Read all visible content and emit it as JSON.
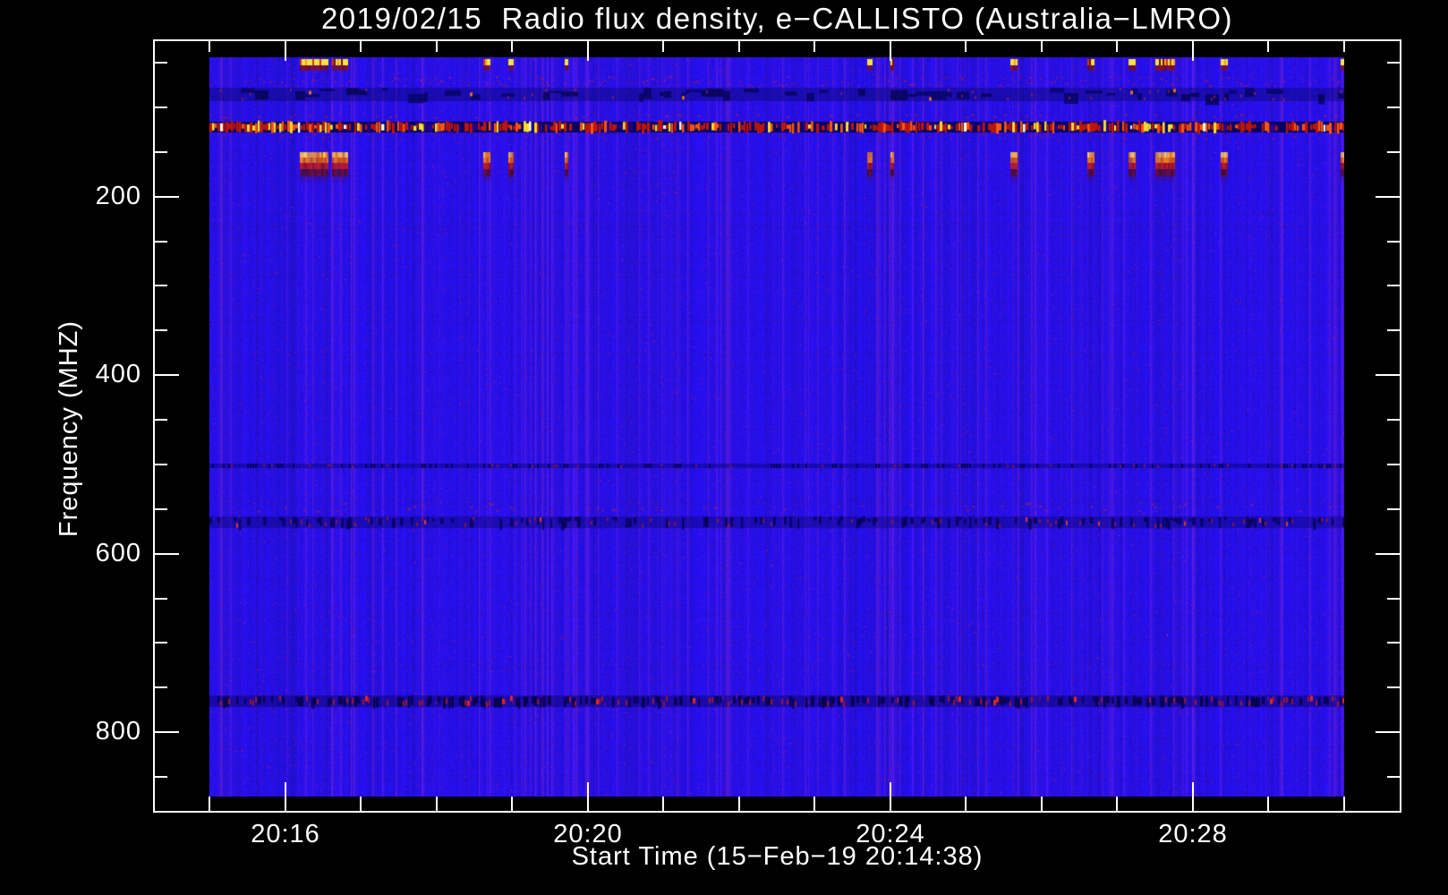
{
  "chart_data": {
    "type": "heatmap",
    "variant": "radio-spectrogram",
    "title": "2019/02/15  Radio flux density, e−CALLISTO (Australia−LMRO)",
    "xlabel": "Start Time (15−Feb−19 20:14:38)",
    "ylabel": "Frequency (MHZ)",
    "x_start_time": "20:15:00",
    "x_range_seconds": [
      0,
      900
    ],
    "x_minor_step_minutes": 1,
    "x_major_ticks": [
      {
        "t_min": 1,
        "label": "20:16"
      },
      {
        "t_min": 5,
        "label": "20:20"
      },
      {
        "t_min": 9,
        "label": "20:24"
      },
      {
        "t_min": 13,
        "label": "20:28"
      }
    ],
    "y_range_mhz": [
      44,
      872
    ],
    "y_minor_step_mhz": 50,
    "y_major_ticks": [
      {
        "f": 200,
        "label": "200"
      },
      {
        "f": 400,
        "label": "400"
      },
      {
        "f": 600,
        "label": "600"
      },
      {
        "f": 800,
        "label": "800"
      }
    ],
    "grid": false,
    "legend": false,
    "axis_color": "#ffffff",
    "text_color": "#ffffff",
    "plot_background": "#000000",
    "base_flux_color": "#2a12ea",
    "colormap_note": "blue = low flux, red/orange/yellow = high flux (RFI)",
    "rfi_bands_mhz": [
      {
        "f_lo": 65,
        "f_hi": 78,
        "style": "speckle-red",
        "desc": "weak broadband noise speckle"
      },
      {
        "f_lo": 78,
        "f_hi": 93,
        "style": "dark-blotch",
        "desc": "dark patchy band with red speckles"
      },
      {
        "f_lo": 107,
        "f_hi": 113,
        "style": "sparse-red",
        "desc": "faint interference row"
      },
      {
        "f_lo": 116,
        "f_hi": 128,
        "style": "dense-dash",
        "desc": "strong RFI line ~120 MHz, red/orange/yellow dashes on dark strip"
      },
      {
        "f_lo": 499,
        "f_hi": 504,
        "style": "thin-dark",
        "desc": "thin RFI line ~501 MHz"
      },
      {
        "f_lo": 543,
        "f_hi": 554,
        "style": "sparse-red",
        "desc": "faint speckle row ~548 MHz"
      },
      {
        "f_lo": 558,
        "f_hi": 571,
        "style": "dark-dash",
        "desc": "RFI band ~565 MHz with dark/red dashes"
      },
      {
        "f_lo": 759,
        "f_hi": 772,
        "style": "dark-dash-strong",
        "desc": "strong RFI band ~765 MHz, dark/red dashes"
      }
    ],
    "bursts": {
      "desc": "intermittent broadband RFI bursts (bright columns)",
      "upper_dash_mhz": [
        46,
        59
      ],
      "lower_blob_mhz": [
        150,
        177
      ],
      "times_s": [
        [
          72,
          95
        ],
        [
          97,
          109
        ],
        [
          217,
          222
        ],
        [
          237,
          241
        ],
        [
          282,
          285
        ],
        [
          522,
          526
        ],
        [
          540,
          543
        ],
        [
          635,
          641
        ],
        [
          696,
          701
        ],
        [
          729,
          735
        ],
        [
          750,
          765
        ],
        [
          802,
          808
        ],
        [
          897,
          900
        ]
      ]
    }
  }
}
